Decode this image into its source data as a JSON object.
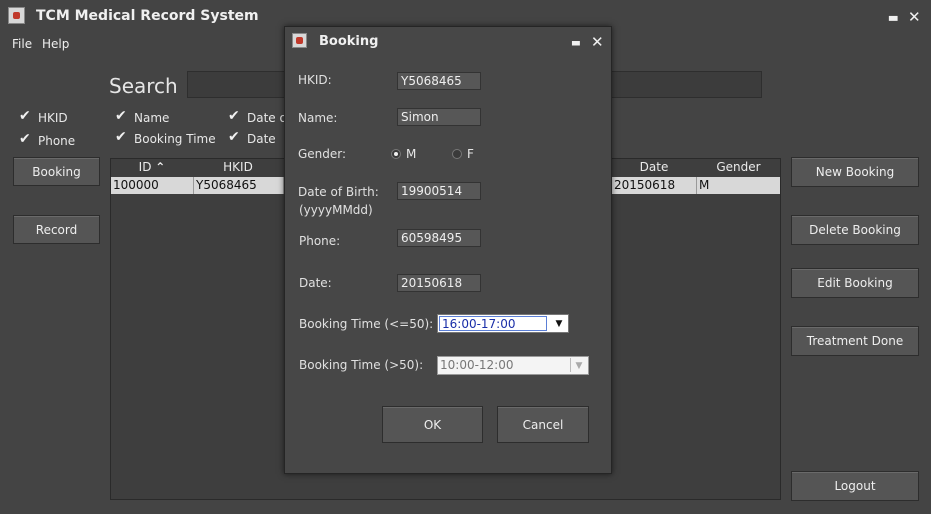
{
  "window": {
    "title": "TCM Medical Record System",
    "minimize": "▃",
    "close": "✕"
  },
  "menu": [
    "File",
    "Help"
  ],
  "search": {
    "label": "Search",
    "value": ""
  },
  "filters": [
    {
      "label": "HKID",
      "checked": true
    },
    {
      "label": "Name",
      "checked": true
    },
    {
      "label": "Date of",
      "checked": true
    },
    {
      "label": "Phone",
      "checked": true
    },
    {
      "label": "Booking Time",
      "checked": true
    },
    {
      "label": "Date",
      "checked": true
    }
  ],
  "left_buttons": [
    "Booking",
    "Record"
  ],
  "right_buttons": [
    "New Booking",
    "Delete Booking",
    "Edit Booking",
    "Treatment Done",
    "Logout"
  ],
  "table": {
    "headers": {
      "id": "ID",
      "hkid": "HKID",
      "date": "Date",
      "gender": "Gender"
    },
    "sort_glyph": "⌃",
    "rows": [
      {
        "id": "100000",
        "hkid": "Y5068465",
        "date": "20150618",
        "gender": "M"
      }
    ]
  },
  "dialog": {
    "title": "Booking",
    "minimize": "▃",
    "close": "✕",
    "hkid_label": "HKID:",
    "hkid_value": "Y5068465",
    "name_label": "Name:",
    "name_value": "Simon",
    "gender_label": "Gender:",
    "gender_m": "M",
    "gender_f": "F",
    "gender_selected": "M",
    "dob_label": "Date of Birth:",
    "dob_hint": "(yyyyMMdd)",
    "dob_value": "19900514",
    "phone_label": "Phone:",
    "phone_value": "60598495",
    "date_label": "Date:",
    "date_value": "20150618",
    "bt1_label": "Booking Time (<=50):",
    "bt1_value": "16:00-17:00",
    "bt2_label": "Booking Time (>50):",
    "bt2_value": "10:00-12:00",
    "ok": "OK",
    "cancel": "Cancel",
    "arrow": "▼"
  }
}
